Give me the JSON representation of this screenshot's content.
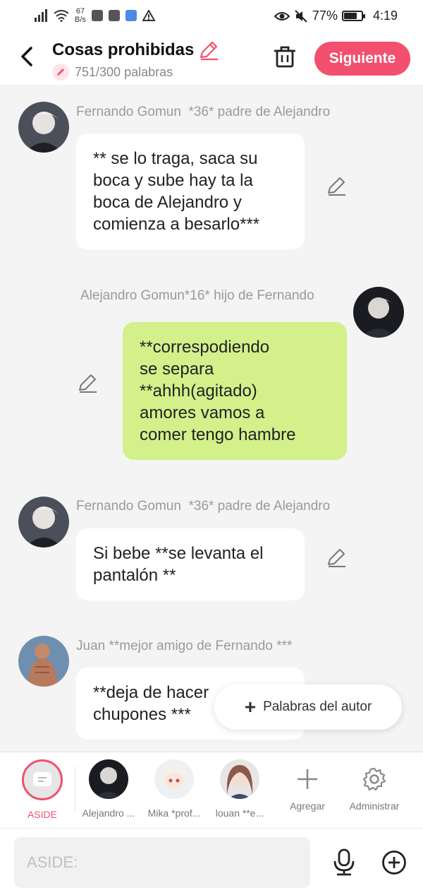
{
  "status_bar": {
    "net_speed_value": "67",
    "net_speed_unit": "B/s",
    "battery": "77%",
    "battery_level": 0.77,
    "time": "4:19"
  },
  "header": {
    "title": "Cosas prohibidas",
    "word_count": "751/300 palabras",
    "next_label": "Siguiente",
    "accent_color": "#f2506e"
  },
  "messages": [
    {
      "sender": "Fernando Gomun  *36* padre de Alejandro",
      "text": "** se lo traga, saca su\nboca y sube hay ta la\nboca de Alejandro y\ncomienza a besarlo***",
      "side": "left",
      "bubble_color": "#ffffff"
    },
    {
      "sender": "Alejandro Gomun*16* hijo de Fernando",
      "text": "**correspodiendo\nse separa\n**ahhh(agitado)\namores vamos a\ncomer tengo hambre",
      "side": "right",
      "bubble_color": "#d3f08a"
    },
    {
      "sender": "Fernando Gomun  *36* padre de Alejandro",
      "text": "Si bebe **se levanta el\npantalón **",
      "side": "left",
      "bubble_color": "#ffffff"
    },
    {
      "sender": "Juan **mejor amigo de Fernando ***",
      "text": "**deja de hacer\nchupones ***",
      "side": "left",
      "bubble_color": "#ffffff"
    }
  ],
  "floating_button": {
    "label": "Palabras del autor",
    "icon": "plus-icon"
  },
  "characters": [
    {
      "label": "ASIDE",
      "icon": "chat-bubble-icon",
      "selected": true
    },
    {
      "label": "Alejandro ..."
    },
    {
      "label": "Mika *prof..."
    },
    {
      "label": "louan **e..."
    },
    {
      "label": "Agregar",
      "icon": "plus-icon"
    },
    {
      "label": "Administrar",
      "icon": "gear-icon"
    }
  ],
  "composer": {
    "placeholder": "ASIDE:",
    "mic_icon": "microphone-icon",
    "add_icon": "plus-circle-icon"
  }
}
